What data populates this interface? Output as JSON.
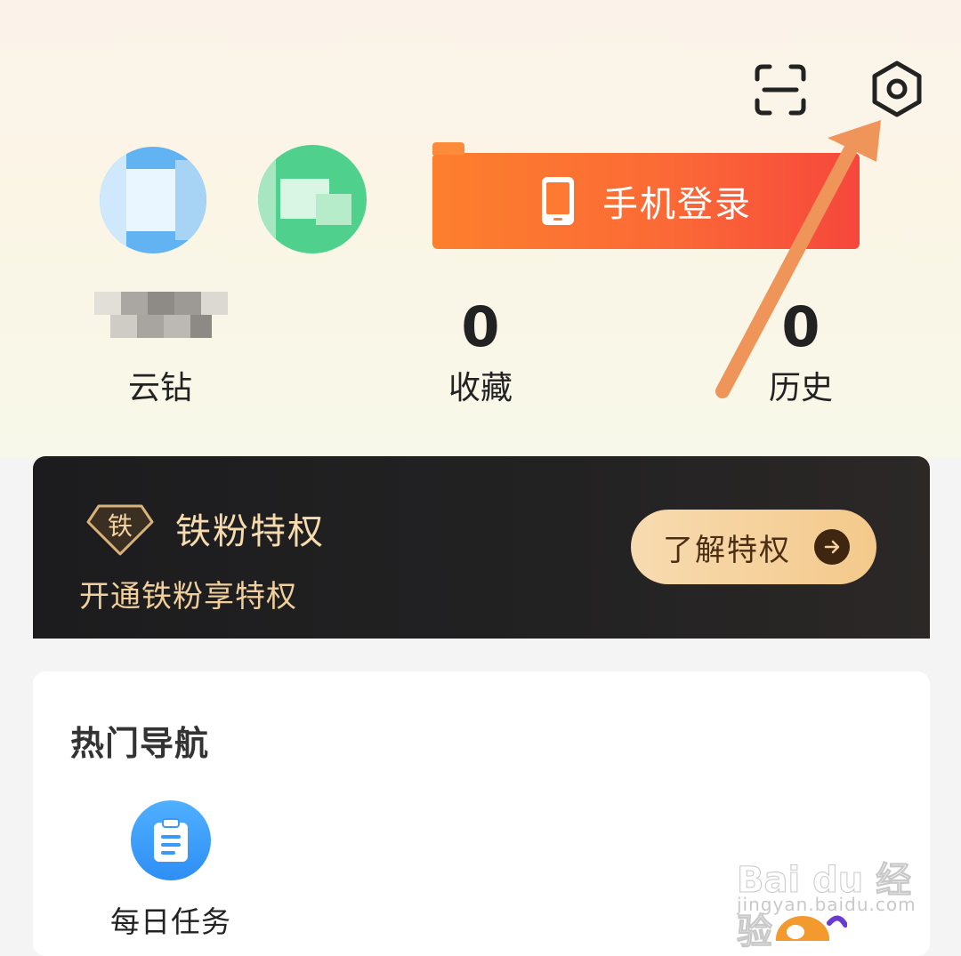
{
  "header": {
    "scan_icon": "scan-icon",
    "settings_icon": "settings-icon"
  },
  "login": {
    "phone_login_label": "手机登录"
  },
  "stats": [
    {
      "value": "",
      "label": "云钻"
    },
    {
      "value": "0",
      "label": "收藏"
    },
    {
      "value": "0",
      "label": "历史"
    }
  ],
  "vip": {
    "badge_text": "铁",
    "title": "铁粉特权",
    "subtitle": "开通铁粉享特权",
    "button_label": "了解特权"
  },
  "hot_nav": {
    "title": "热门导航",
    "items": [
      {
        "label": "每日任务",
        "icon": "clipboard-icon"
      }
    ]
  },
  "watermark": {
    "main": "Bai du 经验",
    "sub": "jingyan.baidu.com"
  },
  "colors": {
    "login_button": "#fb6a36",
    "vip_card": "#1c1c1e",
    "vip_gold": "#f7dbad",
    "annotation_arrow": "#f0955a",
    "nav_icon": "#3a9af7"
  }
}
